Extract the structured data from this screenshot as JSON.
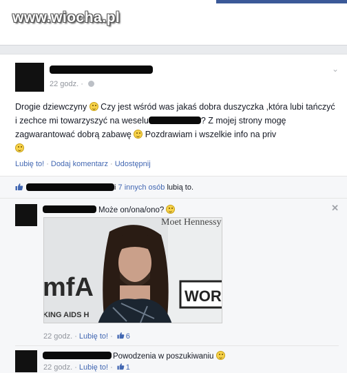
{
  "watermark": "www.wiocha.pl",
  "post": {
    "time": "22 godz.",
    "text_part1": "Drogie dziewczyny ",
    "text_part2": " Czy jest wśród was jakaś dobra duszyczka ,która lubi tańczyć i zechce mi towarzyszyć na weselu",
    "text_part3": "? Z mojej strony mogę zagwarantować dobrą zabawę ",
    "text_part4": " Pozdrawiam i wszelkie info na priv",
    "actions": {
      "like": "Lubię to!",
      "comment": "Dodaj komentarz",
      "share": "Udostępnij"
    }
  },
  "likes": {
    "prefix": "i",
    "others": "7 innych osób",
    "suffix": "lubią to."
  },
  "comments": [
    {
      "text": "Może on/ona/ono?",
      "photo_text": {
        "banner": "Moet Hennessy",
        "brand": "mfA",
        "word": "WOR",
        "tagline": "KING AIDS H"
      },
      "time": "22 godz.",
      "like_label": "Lubię to!",
      "like_count": "6"
    },
    {
      "text": "Powodzenia w poszukiwaniu",
      "time": "22 godz.",
      "like_label": "Lubię to!",
      "like_count": "1"
    }
  ],
  "colors": {
    "link": "#4267b2",
    "meta": "#90949c",
    "background": "#e9ebee",
    "redaction": "#0a0a0a"
  }
}
